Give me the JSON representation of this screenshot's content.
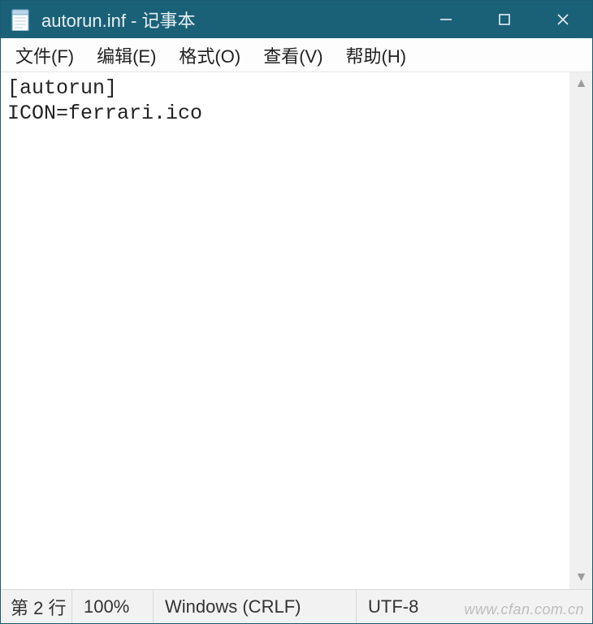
{
  "window": {
    "title": "autorun.inf - 记事本",
    "icon": "notepad-icon"
  },
  "menubar": {
    "items": [
      {
        "label": "文件(F)"
      },
      {
        "label": "编辑(E)"
      },
      {
        "label": "格式(O)"
      },
      {
        "label": "查看(V)"
      },
      {
        "label": "帮助(H)"
      }
    ]
  },
  "editor": {
    "content": "[autorun]\nICON=ferrari.ico"
  },
  "statusbar": {
    "position": "第 2 行",
    "zoom": "100%",
    "line_ending": "Windows (CRLF)",
    "encoding": "UTF-8"
  },
  "watermark": "www.cfan.com.cn"
}
